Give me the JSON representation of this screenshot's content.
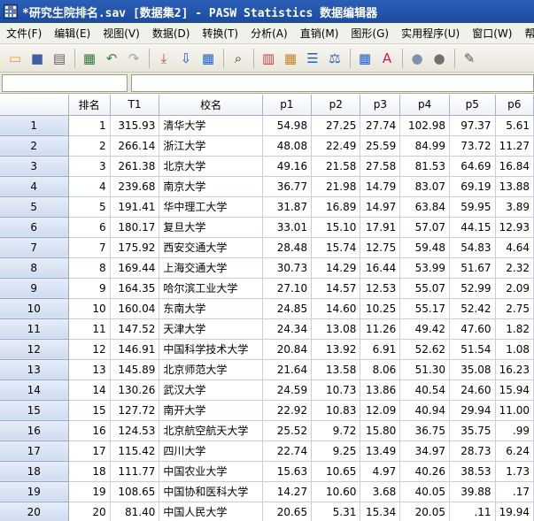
{
  "window": {
    "title": "*研究生院排名.sav [数据集2] - PASW Statistics 数据编辑器"
  },
  "menu": [
    "文件(F)",
    "编辑(E)",
    "视图(V)",
    "数据(D)",
    "转换(T)",
    "分析(A)",
    "直销(M)",
    "图形(G)",
    "实用程序(U)",
    "窗口(W)",
    "帮"
  ],
  "toolbar": {
    "buttons": [
      "open-icon",
      "save-icon",
      "print-icon",
      "recall-dialog-icon",
      "undo-icon",
      "redo-icon",
      "goto-case-icon",
      "goto-variable-icon",
      "variables-icon",
      "find-icon",
      "insert-cases-icon",
      "insert-variable-icon",
      "split-file-icon",
      "weight-cases-icon",
      "select-cases-icon",
      "value-labels-icon",
      "use-sets-icon",
      "show-all-icon",
      "spelling-icon"
    ]
  },
  "cellbar": {
    "ref": "",
    "value": ""
  },
  "colors": {
    "title": "#1a4b9e",
    "rowheader": "#d6e1f3",
    "grid": "#c7cfdd"
  },
  "table": {
    "columns": [
      "",
      "排名",
      "T1",
      "校名",
      "p1",
      "p2",
      "p3",
      "p4",
      "p5",
      "p6"
    ],
    "rows": [
      [
        "1",
        "1",
        "315.93",
        "清华大学",
        "54.98",
        "27.25",
        "27.74",
        "102.98",
        "97.37",
        "5.61"
      ],
      [
        "2",
        "2",
        "266.14",
        "浙江大学",
        "48.08",
        "22.49",
        "25.59",
        "84.99",
        "73.72",
        "11.27"
      ],
      [
        "3",
        "3",
        "261.38",
        "北京大学",
        "49.16",
        "21.58",
        "27.58",
        "81.53",
        "64.69",
        "16.84"
      ],
      [
        "4",
        "4",
        "239.68",
        "南京大学",
        "36.77",
        "21.98",
        "14.79",
        "83.07",
        "69.19",
        "13.88"
      ],
      [
        "5",
        "5",
        "191.41",
        "华中理工大学",
        "31.87",
        "16.89",
        "14.97",
        "63.84",
        "59.95",
        "3.89"
      ],
      [
        "6",
        "6",
        "180.17",
        "复旦大学",
        "33.01",
        "15.10",
        "17.91",
        "57.07",
        "44.15",
        "12.93"
      ],
      [
        "7",
        "7",
        "175.92",
        "西安交通大学",
        "28.48",
        "15.74",
        "12.75",
        "59.48",
        "54.83",
        "4.64"
      ],
      [
        "8",
        "8",
        "169.44",
        "上海交通大学",
        "30.73",
        "14.29",
        "16.44",
        "53.99",
        "51.67",
        "2.32"
      ],
      [
        "9",
        "9",
        "164.35",
        "哈尔滨工业大学",
        "27.10",
        "14.57",
        "12.53",
        "55.07",
        "52.99",
        "2.09"
      ],
      [
        "10",
        "10",
        "160.04",
        "东南大学",
        "24.85",
        "14.60",
        "10.25",
        "55.17",
        "52.42",
        "2.75"
      ],
      [
        "11",
        "11",
        "147.52",
        "天津大学",
        "24.34",
        "13.08",
        "11.26",
        "49.42",
        "47.60",
        "1.82"
      ],
      [
        "12",
        "12",
        "146.91",
        "中国科学技术大学",
        "20.84",
        "13.92",
        "6.91",
        "52.62",
        "51.54",
        "1.08"
      ],
      [
        "13",
        "13",
        "145.89",
        "北京师范大学",
        "21.64",
        "13.58",
        "8.06",
        "51.30",
        "35.08",
        "16.23"
      ],
      [
        "14",
        "14",
        "130.26",
        "武汉大学",
        "24.59",
        "10.73",
        "13.86",
        "40.54",
        "24.60",
        "15.94"
      ],
      [
        "15",
        "15",
        "127.72",
        "南开大学",
        "22.92",
        "10.83",
        "12.09",
        "40.94",
        "29.94",
        "11.00"
      ],
      [
        "16",
        "16",
        "124.53",
        "北京航空航天大学",
        "25.52",
        "9.72",
        "15.80",
        "36.75",
        "35.75",
        ".99"
      ],
      [
        "17",
        "17",
        "115.42",
        "四川大学",
        "22.74",
        "9.25",
        "13.49",
        "34.97",
        "28.73",
        "6.24"
      ],
      [
        "18",
        "18",
        "111.77",
        "中国农业大学",
        "15.63",
        "10.65",
        "4.97",
        "40.26",
        "38.53",
        "1.73"
      ],
      [
        "19",
        "19",
        "108.65",
        "中国协和医科大学",
        "14.27",
        "10.60",
        "3.68",
        "40.05",
        "39.88",
        ".17"
      ],
      [
        "20",
        "20",
        "81.40",
        "中国人民大学",
        "20.65",
        "5.31",
        "15.34",
        "20.05",
        ".11",
        "19.94"
      ]
    ]
  }
}
